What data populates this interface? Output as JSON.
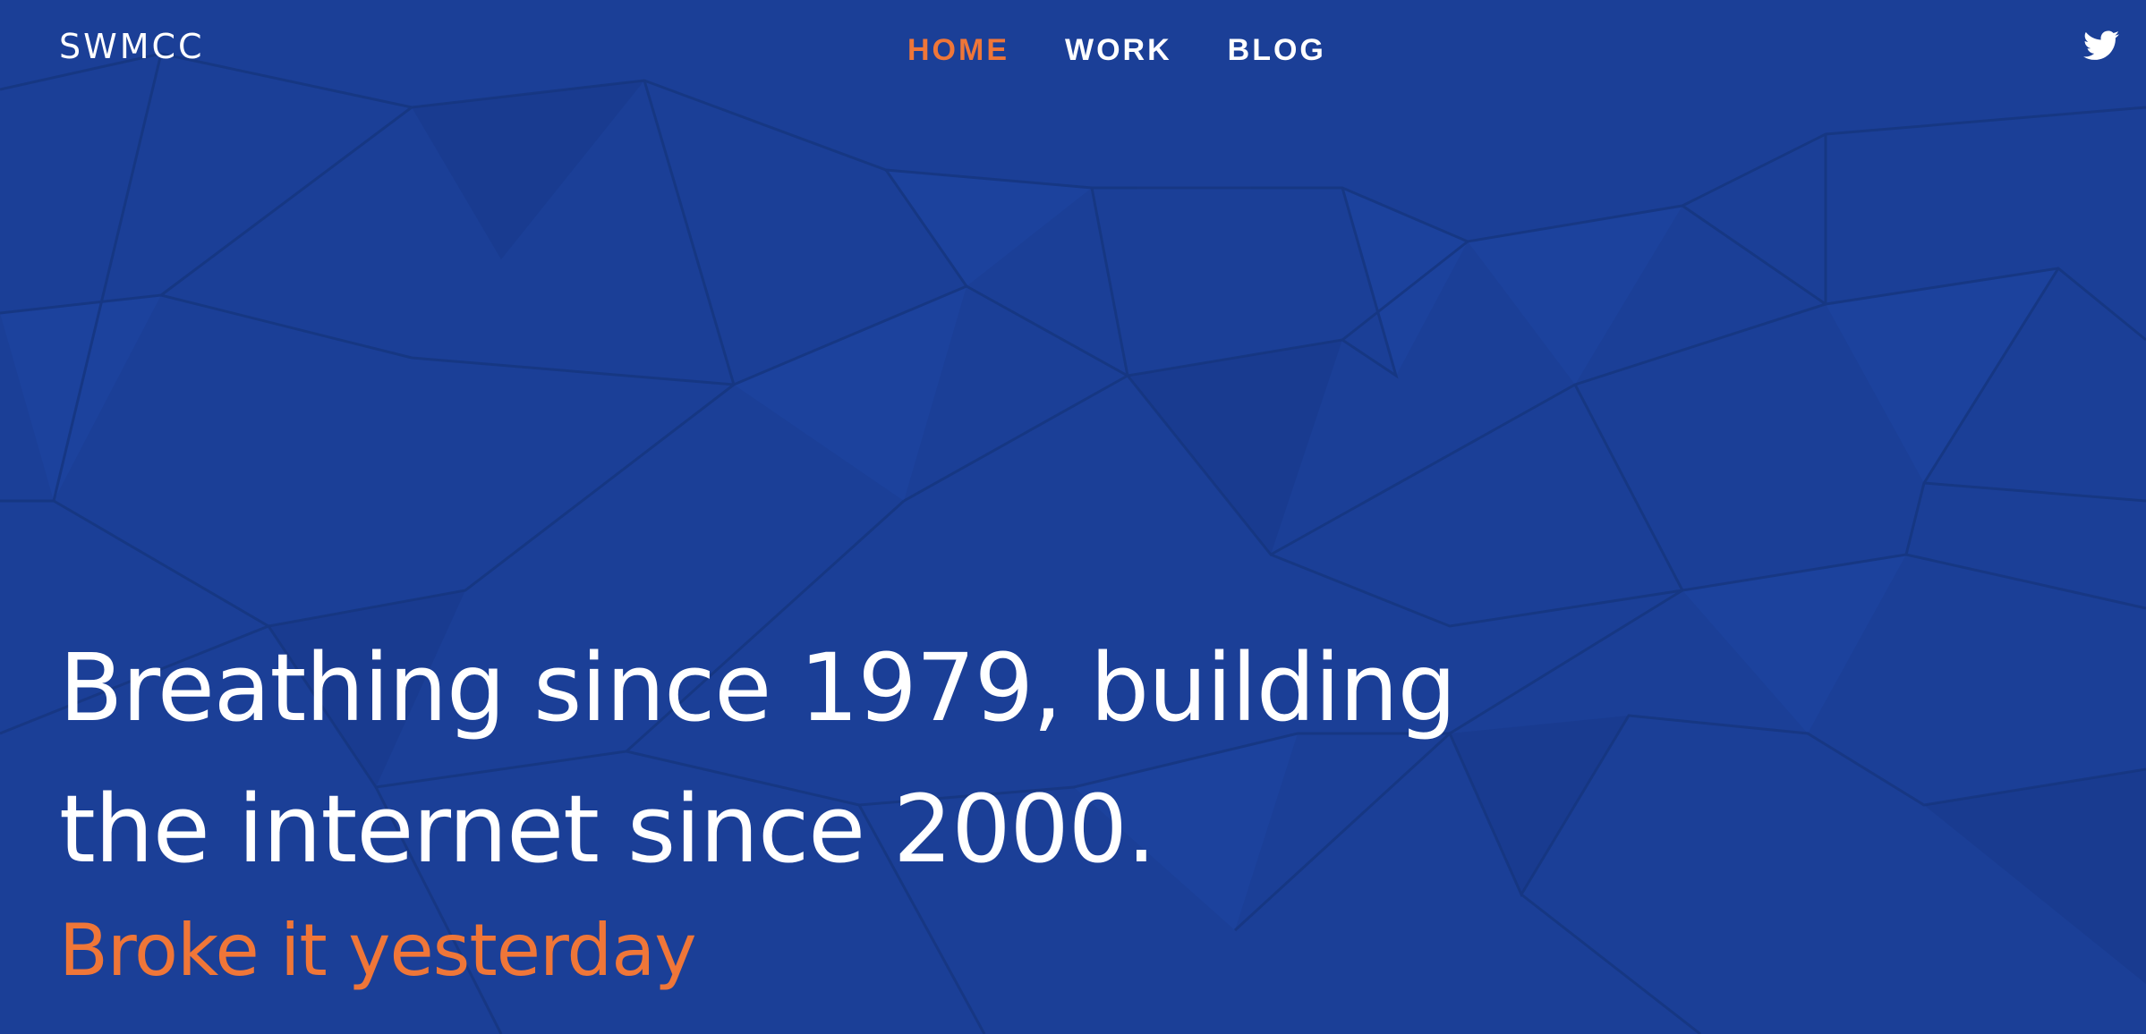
{
  "colors": {
    "background": "#1b3f97",
    "accent": "#ef7638",
    "text": "#ffffff"
  },
  "header": {
    "logo": "SWMCC",
    "nav": [
      {
        "label": "HOME",
        "active": true
      },
      {
        "label": "WORK",
        "active": false
      },
      {
        "label": "BLOG",
        "active": false
      }
    ],
    "social_icon": "twitter-icon"
  },
  "hero": {
    "headline_line1": "Breathing since 1979, building",
    "headline_line2": "the internet since 2000.",
    "subheadline": "Broke it yesterday"
  }
}
